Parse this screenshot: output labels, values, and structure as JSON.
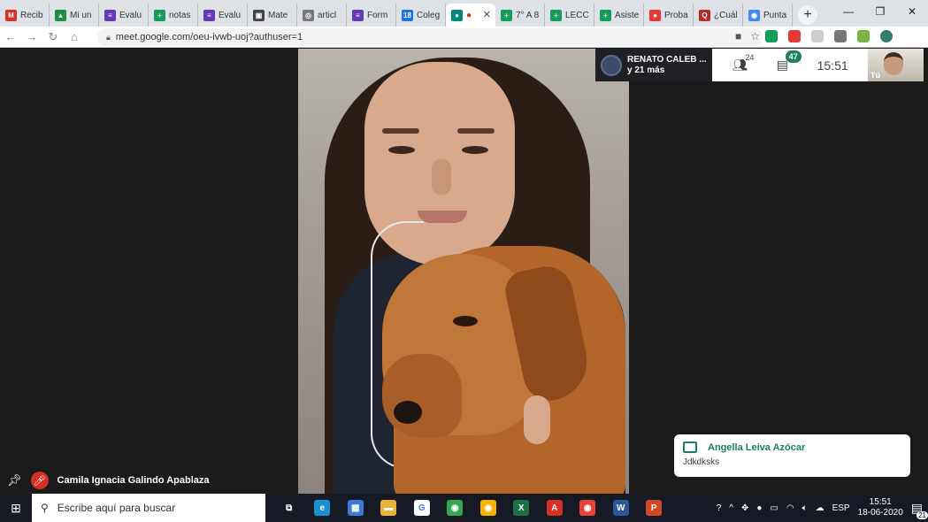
{
  "browser": {
    "tabs": [
      {
        "label": "Recib",
        "icon": "gmail-icon",
        "color": "#d93025",
        "glyph": "M"
      },
      {
        "label": "Mi un",
        "icon": "drive-icon",
        "color": "#1e8e3e",
        "glyph": "▲"
      },
      {
        "label": "Evalu",
        "icon": "forms-icon",
        "color": "#673ab7",
        "glyph": "≡"
      },
      {
        "label": "notas",
        "icon": "sheets-icon",
        "color": "#0f9d58",
        "glyph": "+"
      },
      {
        "label": "Evalu",
        "icon": "forms-icon",
        "color": "#673ab7",
        "glyph": "≡"
      },
      {
        "label": "Mate",
        "icon": "classroom-icon",
        "color": "#444444",
        "glyph": "▣"
      },
      {
        "label": "articl",
        "icon": "globe-icon",
        "color": "#777777",
        "glyph": "◎"
      },
      {
        "label": "Form",
        "icon": "forms-icon",
        "color": "#673ab7",
        "glyph": "≡"
      },
      {
        "label": "Coleg",
        "icon": "calendar-icon",
        "color": "#1a73e8",
        "glyph": "18"
      },
      {
        "label": "",
        "icon": "meet-icon",
        "color": "#00897b",
        "glyph": "●",
        "active": true,
        "recording": "●",
        "close": "✕"
      },
      {
        "label": "7° A 8",
        "icon": "sheets-icon",
        "color": "#0f9d58",
        "glyph": "+"
      },
      {
        "label": "LECC",
        "icon": "sheets-icon",
        "color": "#0f9d58",
        "glyph": "+"
      },
      {
        "label": "Asiste",
        "icon": "sheets-icon",
        "color": "#0f9d58",
        "glyph": "+"
      },
      {
        "label": "Proba",
        "icon": "youtube-icon",
        "color": "#e53935",
        "glyph": "●"
      },
      {
        "label": "¿Cuál",
        "icon": "quora-icon",
        "color": "#b92b27",
        "glyph": "Q"
      },
      {
        "label": "Punta",
        "icon": "edge-icon",
        "color": "#4285f4",
        "glyph": "◉"
      }
    ],
    "new_tab": "+",
    "url": "meet.google.com/oeu-ivwb-uoj?authuser=1",
    "window_controls": {
      "minimize": "—",
      "restore": "❐",
      "close": "✕"
    }
  },
  "meet": {
    "others_name": "RENATO CALEB ...",
    "others_more": "y 21 más",
    "participants_count": "24",
    "chat_badge": "47",
    "clock": "15:51",
    "self_label": "Tú",
    "speaker_name": "Camila Ignacia Galindo Apablaza",
    "notification": {
      "sender": "Angella Leiva Azócar",
      "message": "Jdkdksks"
    }
  },
  "taskbar": {
    "search_placeholder": "Escribe aquí para buscar",
    "apps": [
      {
        "name": "task-view-icon",
        "color": "#161a24",
        "glyph": "⧉"
      },
      {
        "name": "edge-icon",
        "color": "#1a8fd1",
        "glyph": "e"
      },
      {
        "name": "store-icon",
        "color": "#3a7bd5",
        "glyph": "▦"
      },
      {
        "name": "explorer-icon",
        "color": "#e8b339",
        "glyph": "▬"
      },
      {
        "name": "google-icon",
        "color": "#ffffff",
        "glyph": "G"
      },
      {
        "name": "chrome-icon",
        "color": "#34a853",
        "glyph": "◉"
      },
      {
        "name": "chrome-canary-icon",
        "color": "#f4b400",
        "glyph": "◉"
      },
      {
        "name": "excel-icon",
        "color": "#1d7044",
        "glyph": "X"
      },
      {
        "name": "acrobat-icon",
        "color": "#d93025",
        "glyph": "A"
      },
      {
        "name": "chrome-icon",
        "color": "#ea4335",
        "glyph": "◉"
      },
      {
        "name": "word-icon",
        "color": "#2b579a",
        "glyph": "W"
      },
      {
        "name": "powerpoint-icon",
        "color": "#d24726",
        "glyph": "P"
      }
    ],
    "language": "ESP",
    "time": "15:51",
    "date": "18-06-2020",
    "notifications_count": "21"
  }
}
